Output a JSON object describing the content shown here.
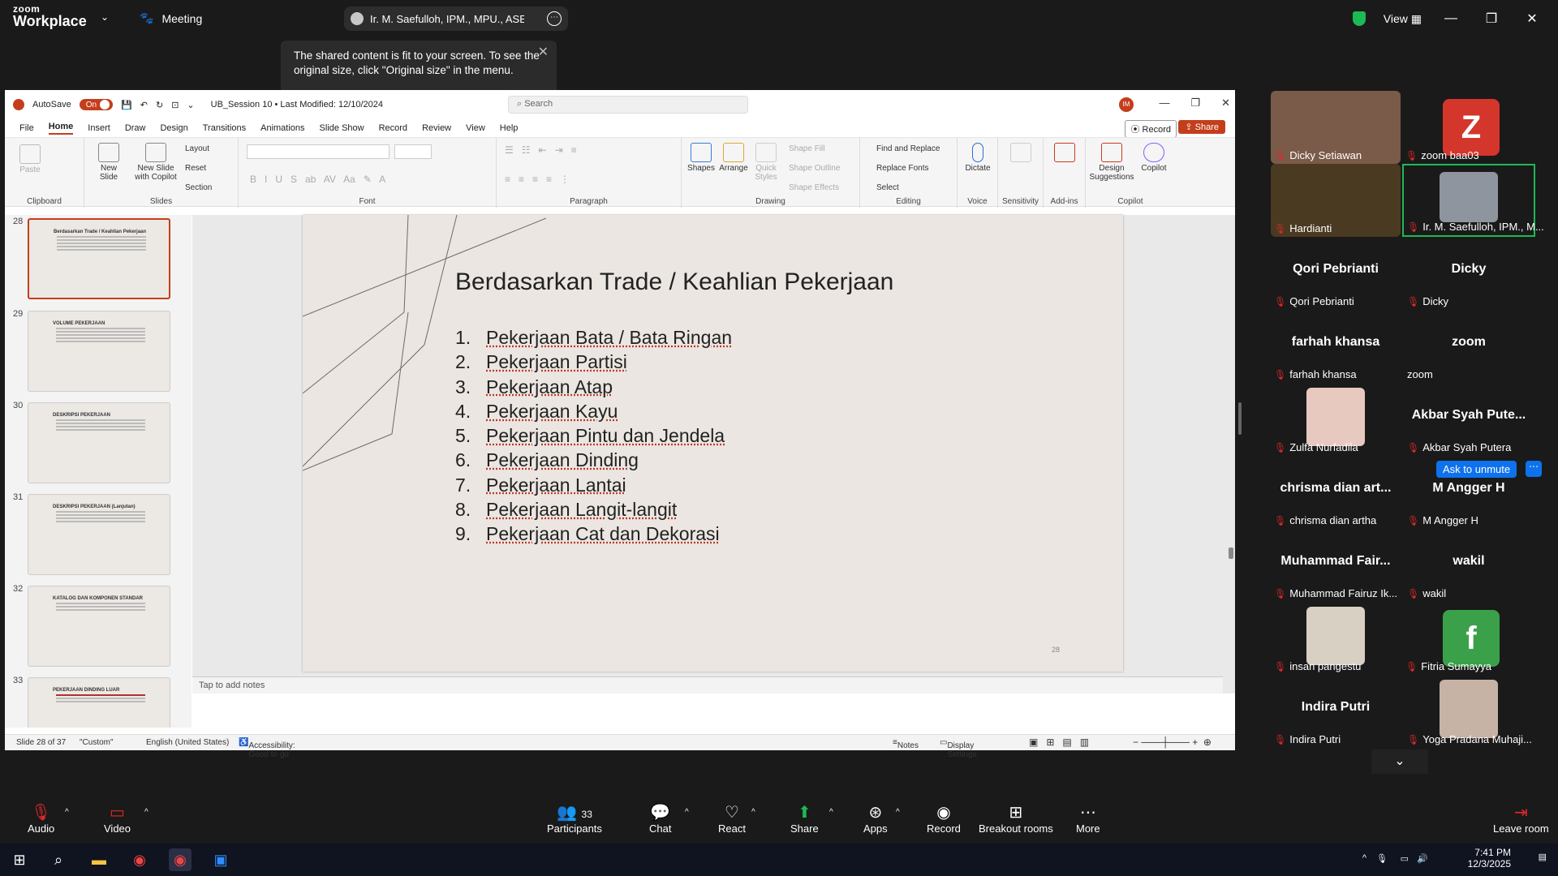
{
  "zoom": {
    "logo_top": "zoom",
    "logo_bottom": "Workplace",
    "meeting": "Meeting",
    "presenter": "Ir. M. Saefulloh, IPM., MPU., ASEAN",
    "view": "View"
  },
  "tooltip": "The shared content is fit to your screen. To see the original size, click \"Original size\" in the menu.",
  "ppt": {
    "autosave": "AutoSave",
    "toggle": "On",
    "filename": "UB_Session 10 • Last Modified: 12/10/2024",
    "search": "Search",
    "user_initials": "IM",
    "tabs": [
      "File",
      "Home",
      "Insert",
      "Draw",
      "Design",
      "Transitions",
      "Animations",
      "Slide Show",
      "Record",
      "Review",
      "View",
      "Help"
    ],
    "record": "Record",
    "share": "Share",
    "ribbon": {
      "paste": "Paste",
      "clipboard": "Clipboard",
      "new_slide": "New Slide",
      "new_slide_copilot": "New Slide with Copilot",
      "layout": "Layout",
      "reset": "Reset",
      "section": "Section",
      "slides": "Slides",
      "font": "Font",
      "paragraph": "Paragraph",
      "shapes": "Shapes",
      "arrange": "Arrange",
      "quick_styles": "Quick Styles",
      "shape_fill": "Shape Fill",
      "shape_outline": "Shape Outline",
      "shape_effects": "Shape Effects",
      "drawing": "Drawing",
      "find_replace": "Find and Replace",
      "replace_fonts": "Replace Fonts",
      "select": "Select",
      "editing": "Editing",
      "dictate": "Dictate",
      "voice": "Voice",
      "sensitivity": "Sensitivity",
      "addins": "Add-ins",
      "design_suggestions": "Design Suggestions",
      "copilot": "Copilot"
    },
    "thumbs": [
      {
        "num": "28",
        "title": "Berdasarkan Trade / Keahlian Pekerjaan"
      },
      {
        "num": "29",
        "title": "VOLUME PEKERJAAN"
      },
      {
        "num": "30",
        "title": "DESKRIPSI PEKERJAAN"
      },
      {
        "num": "31",
        "title": "DESKRIPSI PEKERJAAN (Lanjutan)"
      },
      {
        "num": "32",
        "title": "KATALOG DAN KOMPONEN STANDAR"
      },
      {
        "num": "33",
        "title": "PEKERJAAN DINDING LUAR"
      }
    ],
    "slide": {
      "title": "Berdasarkan Trade / Keahlian Pekerjaan",
      "items": [
        {
          "n": "1.",
          "t": "Pekerjaan Bata / Bata Ringan"
        },
        {
          "n": "2.",
          "t": "Pekerjaan Partisi"
        },
        {
          "n": "3.",
          "t": "Pekerjaan Atap"
        },
        {
          "n": "4.",
          "t": "Pekerjaan Kayu"
        },
        {
          "n": "5.",
          "t": "Pekerjaan Pintu dan Jendela"
        },
        {
          "n": "6.",
          "t": "Pekerjaan Dinding"
        },
        {
          "n": "7.",
          "t": "Pekerjaan Lantai"
        },
        {
          "n": "8.",
          "t": "Pekerjaan Langit-langit"
        },
        {
          "n": "9.",
          "t": "Pekerjaan Cat dan Dekorasi"
        }
      ],
      "number": "28"
    },
    "notes": "Tap to add notes",
    "status": {
      "slide": "Slide 28 of 37",
      "custom": "\"Custom\"",
      "lang": "English (United States)",
      "access": "Accessibility: Good to go",
      "notes": "Notes",
      "display": "Display Settings"
    }
  },
  "gallery": [
    {
      "label": "Dicky Setiawan",
      "kind": "photo",
      "color": "#8a6a55"
    },
    {
      "label": "zoom baa03",
      "kind": "letter",
      "letter": "Z",
      "color": "#d4362b"
    },
    {
      "label": "Hardianti",
      "kind": "photo",
      "color": "#5a4a2a"
    },
    {
      "label": "Ir. M. Saefulloh, IPM., M...",
      "kind": "photo",
      "color": "#9aa0a8"
    },
    {
      "name": "Qori Pebrianti",
      "label": "Qori Pebrianti"
    },
    {
      "name": "Dicky",
      "label": "Dicky"
    },
    {
      "name": "farhah khansa",
      "label": "farhah khansa"
    },
    {
      "name": "zoom",
      "label": "zoom"
    },
    {
      "label": "Zulfa Nurfadila",
      "kind": "photo",
      "color": "#e8c9c0"
    },
    {
      "name": "Akbar Syah Pute...",
      "label": "Akbar Syah Putera"
    },
    {
      "name": "chrisma dian art...",
      "label": "chrisma dian artha"
    },
    {
      "name": "M Angger H",
      "label": "M Angger H"
    },
    {
      "name": "Muhammad Fair...",
      "label": "Muhammad Fairuz Ik..."
    },
    {
      "name": "wakil",
      "label": "wakil"
    },
    {
      "label": "insan pangestu",
      "kind": "photo",
      "color": "#d9d0c4"
    },
    {
      "label": "Fitria Sumayya",
      "kind": "letter",
      "letter": "f",
      "color": "#3aa14a"
    },
    {
      "name": "Indira Putri",
      "label": "Indira Putri"
    },
    {
      "label": "Yoga Pradana Muhaji...",
      "kind": "photo",
      "color": "#c6b3a6"
    }
  ],
  "ask_unmute": "Ask to unmute",
  "controls": {
    "audio": "Audio",
    "video": "Video",
    "participants": "Participants",
    "count": "33",
    "chat": "Chat",
    "react": "React",
    "share": "Share",
    "apps": "Apps",
    "record": "Record",
    "breakout": "Breakout rooms",
    "more": "More",
    "leave": "Leave room"
  },
  "clock": {
    "time": "7:41 PM",
    "date": "12/3/2025"
  }
}
